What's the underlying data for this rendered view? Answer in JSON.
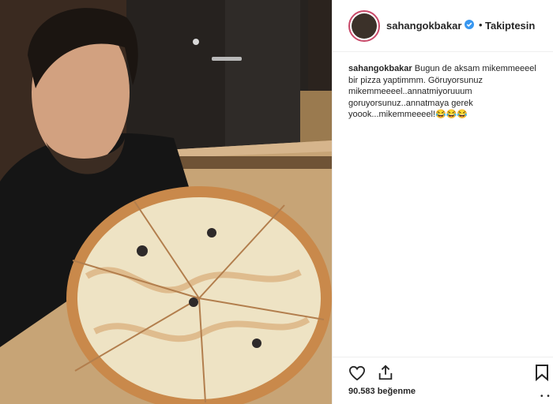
{
  "post": {
    "header": {
      "username": "sahangokbakar",
      "follow_separator": "•",
      "follow_label": "Takiptesin",
      "icons": {
        "verified": "verified-badge-icon"
      }
    },
    "caption": {
      "username": "sahangokbakar",
      "text": " Bugun de aksam mikemmeeeel bir pizza yaptimmm. Göruyorsunuz mikemmeeeel..annatmiyoruuum goruyorsunuz..annatmaya gerek yoook...mikemmeeeel!😂😂😂"
    },
    "actions": {
      "icons": [
        "heart-icon",
        "share-icon",
        "bookmark-icon"
      ]
    },
    "likes": {
      "text": "90.583 beğenme"
    },
    "more": {
      "label": "• •"
    },
    "colors": {
      "verified": "#3897f0",
      "avatar_ring": "#c94a6a",
      "text": "#262626",
      "border": "#efefef"
    }
  }
}
